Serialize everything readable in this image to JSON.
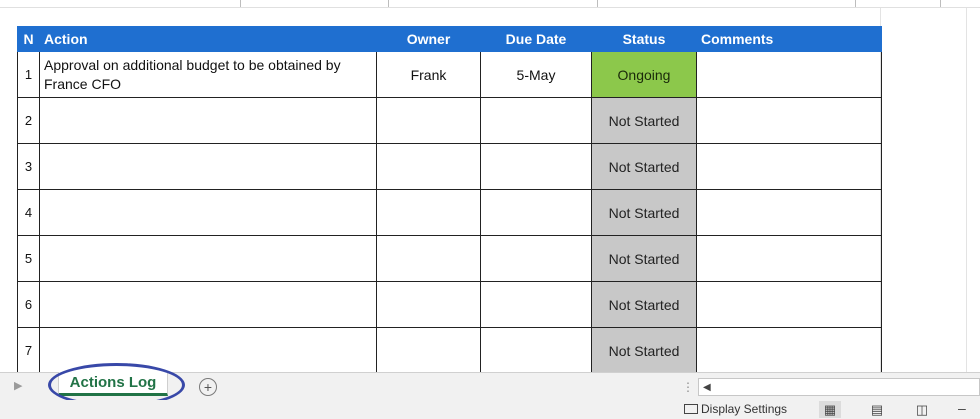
{
  "table": {
    "headers": {
      "n": "N",
      "action": "Action",
      "owner": "Owner",
      "due_date": "Due Date",
      "status": "Status",
      "comments": "Comments"
    },
    "rows": [
      {
        "n": "1",
        "action": "Approval on additional budget to be obtained by France CFO",
        "owner": "Frank",
        "due_date": "5-May",
        "status": "Ongoing",
        "comments": ""
      },
      {
        "n": "2",
        "action": "",
        "owner": "",
        "due_date": "",
        "status": "Not Started",
        "comments": ""
      },
      {
        "n": "3",
        "action": "",
        "owner": "",
        "due_date": "",
        "status": "Not Started",
        "comments": ""
      },
      {
        "n": "4",
        "action": "",
        "owner": "",
        "due_date": "",
        "status": "Not Started",
        "comments": ""
      },
      {
        "n": "5",
        "action": "",
        "owner": "",
        "due_date": "",
        "status": "Not Started",
        "comments": ""
      },
      {
        "n": "6",
        "action": "",
        "owner": "",
        "due_date": "",
        "status": "Not Started",
        "comments": ""
      },
      {
        "n": "7",
        "action": "",
        "owner": "",
        "due_date": "",
        "status": "Not Started",
        "comments": ""
      }
    ]
  },
  "sheet_tabs": {
    "active": "Actions Log",
    "add_icon": "plus-circle-icon"
  },
  "statusbar": {
    "display_settings": "Display Settings",
    "icons": [
      "monitor-icon",
      "normal-view-icon",
      "page-layout-icon",
      "page-break-icon",
      "zoom-out-icon"
    ]
  },
  "colors": {
    "header_blue": "#1f6fd0",
    "ongoing_green": "#8cc84b",
    "not_started_gray": "#c8c8c8",
    "tab_green": "#217346",
    "annotation_circle": "#3848a8"
  }
}
